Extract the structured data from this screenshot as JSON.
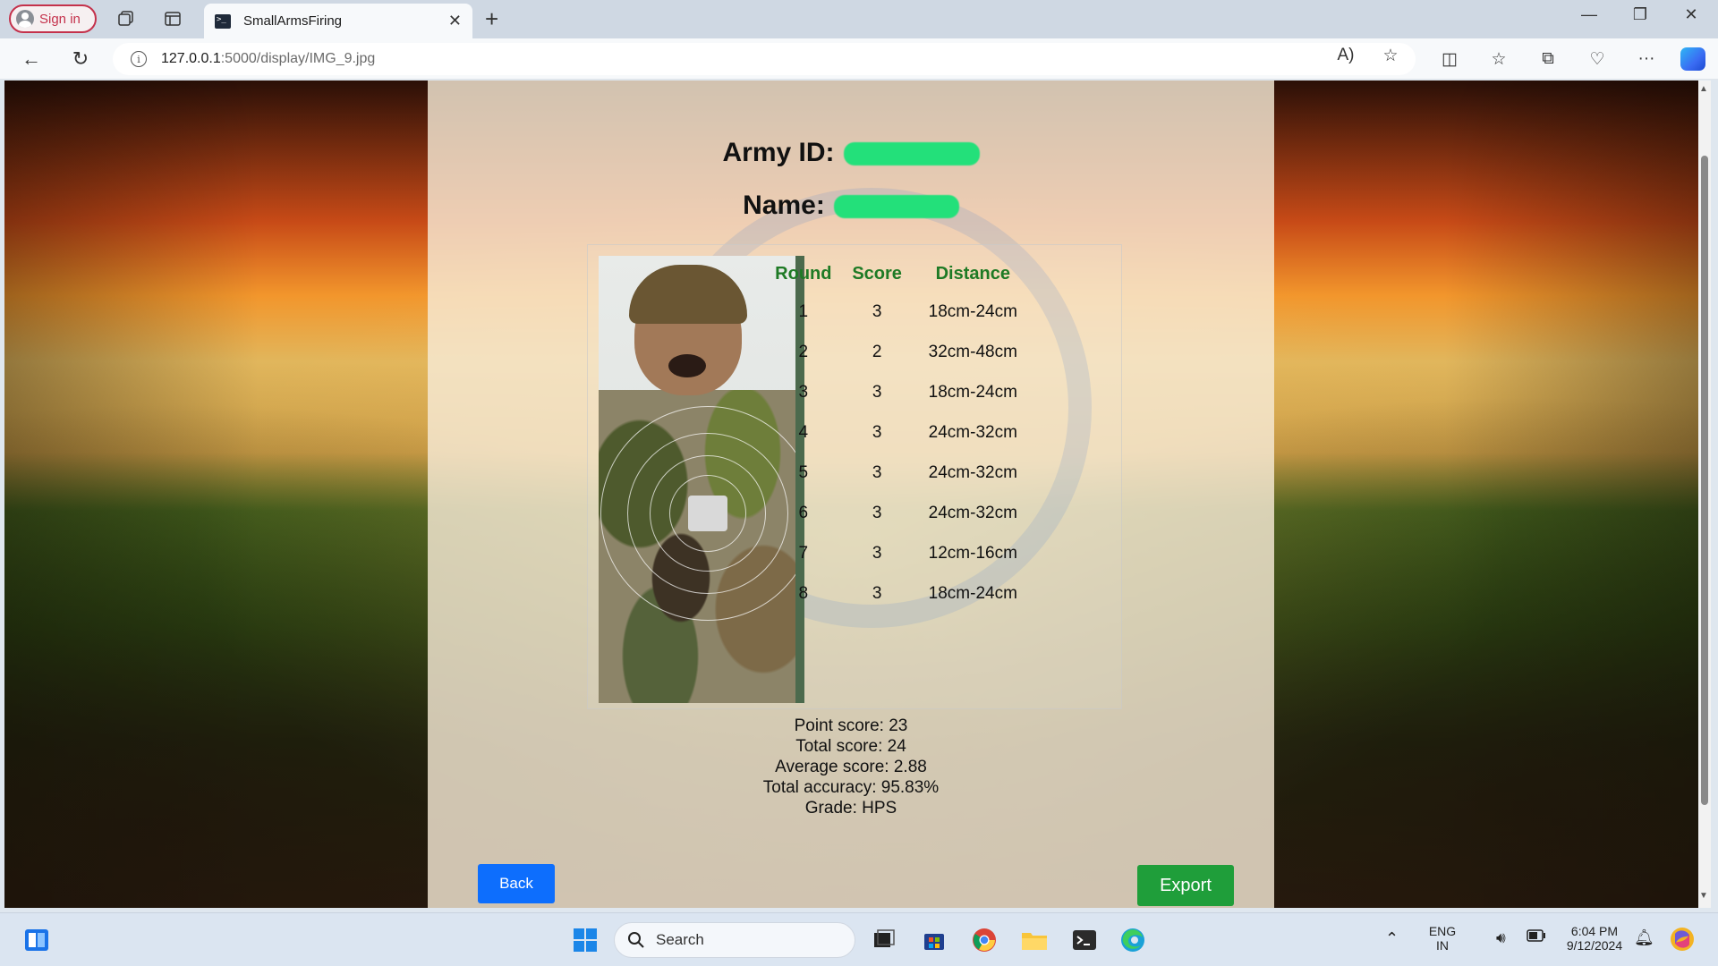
{
  "browser": {
    "signin_label": "Sign in",
    "tab_title": "SmallArmsFiring",
    "url_host": "127.0.0.1",
    "url_path": ":5000/display/IMG_9.jpg"
  },
  "page": {
    "army_id_label": "Army ID:",
    "name_label": "Name:",
    "table_headers": {
      "round": "Round",
      "score": "Score",
      "distance": "Distance"
    },
    "rows": [
      {
        "round": "1",
        "score": "3",
        "distance": "18cm-24cm"
      },
      {
        "round": "2",
        "score": "2",
        "distance": "32cm-48cm"
      },
      {
        "round": "3",
        "score": "3",
        "distance": "18cm-24cm"
      },
      {
        "round": "4",
        "score": "3",
        "distance": "24cm-32cm"
      },
      {
        "round": "5",
        "score": "3",
        "distance": "24cm-32cm"
      },
      {
        "round": "6",
        "score": "3",
        "distance": "24cm-32cm"
      },
      {
        "round": "7",
        "score": "3",
        "distance": "12cm-16cm"
      },
      {
        "round": "8",
        "score": "3",
        "distance": "18cm-24cm"
      }
    ],
    "summary": {
      "point_score": "Point score: 23",
      "total_score": "Total score: 24",
      "average_score": "Average score: 2.88",
      "total_accuracy": "Total accuracy: 95.83%",
      "grade": "Grade: HPS"
    },
    "back_label": "Back",
    "export_label": "Export"
  },
  "taskbar": {
    "search_label": "Search",
    "lang_top": "ENG",
    "lang_bottom": "IN",
    "time": "6:04 PM",
    "date": "9/12/2024"
  },
  "colors": {
    "header_green": "#1e7a25",
    "back_button": "#0d6efd",
    "export_button": "#1f9e3a",
    "redaction": "#23e07a"
  }
}
